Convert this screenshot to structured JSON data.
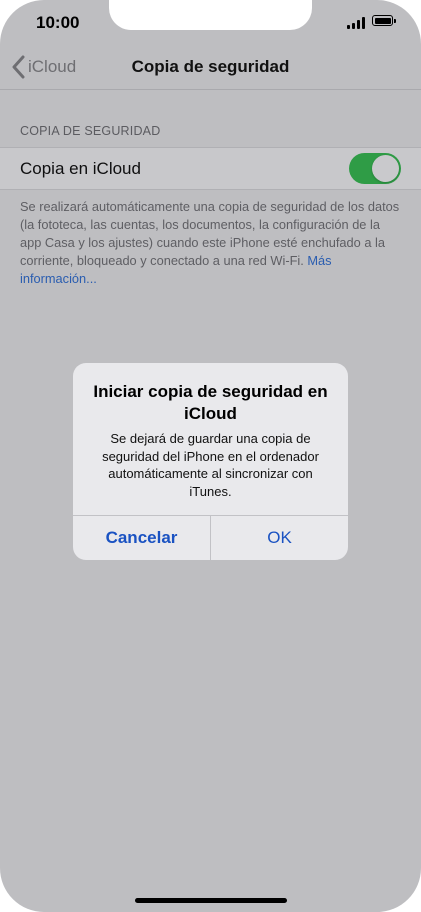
{
  "status_bar": {
    "time": "10:00"
  },
  "nav": {
    "back_label": "iCloud",
    "title": "Copia de seguridad"
  },
  "section": {
    "header": "COPIA DE SEGURIDAD",
    "cell_label": "Copia en iCloud",
    "toggle_on": true,
    "footer_text": "Se realizará automáticamente una copia de seguridad de los datos (la fototeca, las cuentas, los documentos, la configuración de la app Casa y los ajustes) cuando este iPhone esté enchufado a la corriente, bloqueado y conectado a una red Wi-Fi.",
    "footer_link": "Más información..."
  },
  "alert": {
    "title": "Iniciar copia de seguridad en iCloud",
    "message": "Se dejará de guardar una copia de seguridad del iPhone en el ordenador automáticamente al sincronizar con iTunes.",
    "cancel_label": "Cancelar",
    "ok_label": "OK"
  },
  "colors": {
    "toggle_on": "#2f9c46",
    "link": "#2a5db0",
    "dialog_button": "#1a52c2",
    "dim_background": "#bebec1"
  }
}
